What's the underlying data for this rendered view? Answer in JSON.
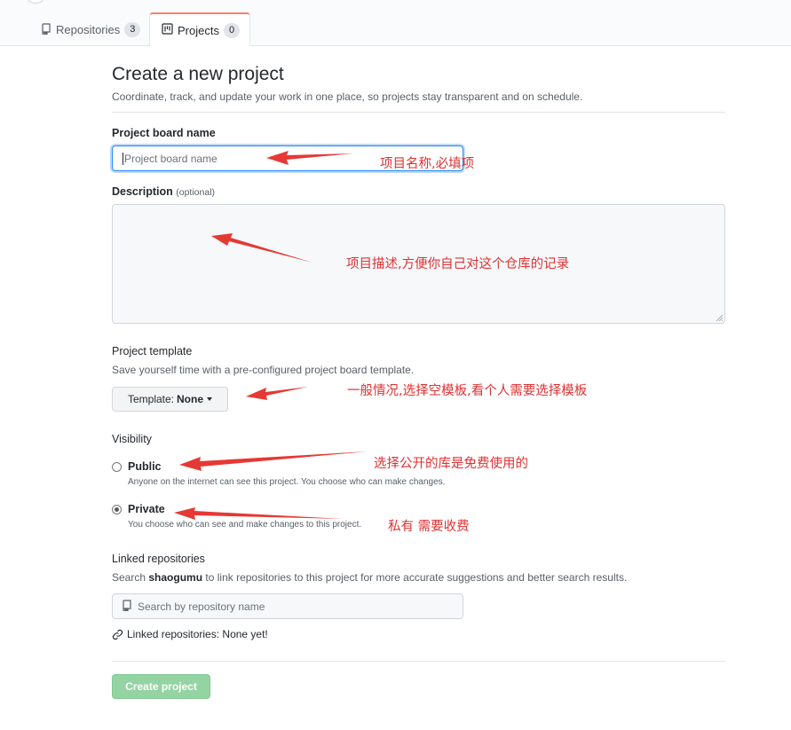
{
  "tabs": [
    {
      "label": "Repositories",
      "count": "3"
    },
    {
      "label": "Projects",
      "count": "0"
    }
  ],
  "page": {
    "title": "Create a new project",
    "subtitle": "Coordinate, track, and update your work in one place, so projects stay transparent and on schedule."
  },
  "form": {
    "name_label": "Project board name",
    "name_placeholder": "Project board name",
    "description_label": "Description",
    "description_optional": "(optional)",
    "template_label": "Project template",
    "template_note": "Save yourself time with a pre-configured project board template.",
    "template_button_prefix": "Template:",
    "template_button_value": "None",
    "visibility_label": "Visibility",
    "public_label": "Public",
    "public_note": "Anyone on the internet can see this project. You choose who can make changes.",
    "private_label": "Private",
    "private_note": "You choose who can see and make changes to this project.",
    "selected_visibility": "Private",
    "linked_label": "Linked repositories",
    "linked_note_prefix": "Search",
    "linked_note_user": "shaogumu",
    "linked_note_suffix": "to link repositories to this project for more accurate suggestions and better search results.",
    "repo_search_placeholder": "Search by repository name",
    "linked_status_label": "Linked repositories:",
    "linked_status_value": "None yet!",
    "create_button": "Create project"
  },
  "annotations": {
    "name": "项目名称,必填项",
    "description": "项目描述,方便你自己对这个仓库的记录",
    "template": "一般情况,选择空模板,看个人需要选择模板",
    "public": "选择公开的库是免费使用的",
    "private": "私有 需要收费"
  },
  "colors": {
    "tab_accent": "#f9826c",
    "focus_border": "#2188ff",
    "create_button": "#94d3a2",
    "annotation": "#e03131"
  },
  "icons": [
    "repo-icon",
    "project-icon",
    "link-icon",
    "dropdown-caret-icon"
  ]
}
